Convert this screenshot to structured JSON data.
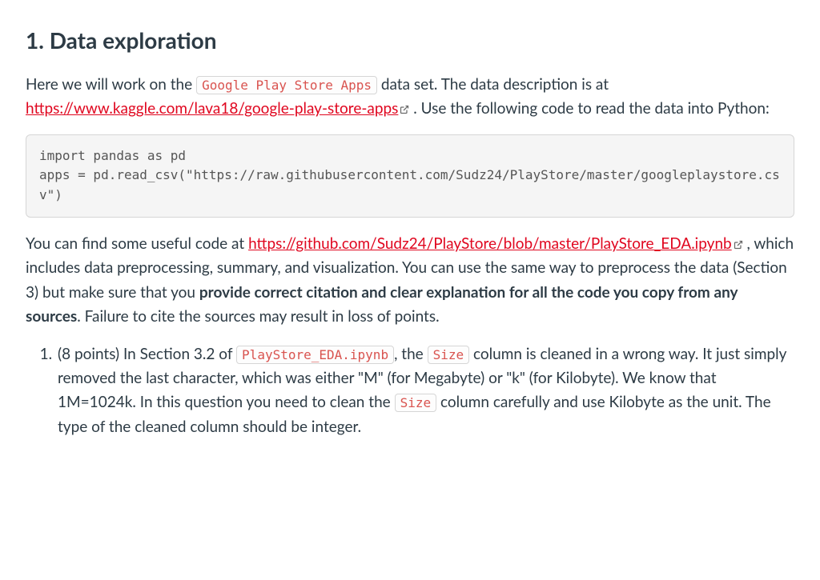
{
  "heading": "1. Data exploration",
  "intro": {
    "part1": "Here we will work on the ",
    "inline_code1": "Google Play Store Apps",
    "part2": " data set. The data description is at ",
    "link1_text": "https://www.kaggle.com/lava18/google-play-store-apps",
    "part3": " . Use the following code to read the data into Python:"
  },
  "code_block": "import pandas as pd\napps = pd.read_csv(\"https://raw.githubusercontent.com/Sudz24/PlayStore/master/googleplaystore.csv\")",
  "para2": {
    "part1": "You can find some useful code at ",
    "link2_text": "https://github.com/Sudz24/PlayStore/blob/master/PlayStore_EDA.ipynb",
    "part2": " , which includes data preprocessing, summary, and visualization. You can use the same way to preprocess the data (Section 3) but make sure that you ",
    "strong_text": "provide correct citation and clear explanation for all the code you copy from any sources",
    "part3": ". Failure to cite the sources may result in loss of points."
  },
  "q1": {
    "part1": "(8 points) In Section 3.2 of ",
    "code1": "PlayStore_EDA.ipynb",
    "part2": ", the ",
    "code2": "Size",
    "part3": " column is cleaned in a wrong way. It just simply removed the last character, which was either \"M\" (for Megabyte) or \"k\" (for Kilobyte). We know that 1M=1024k. In this question you need to clean the ",
    "code3": "Size",
    "part4": " column carefully and use Kilobyte as the unit. The type of the cleaned column should be integer."
  }
}
